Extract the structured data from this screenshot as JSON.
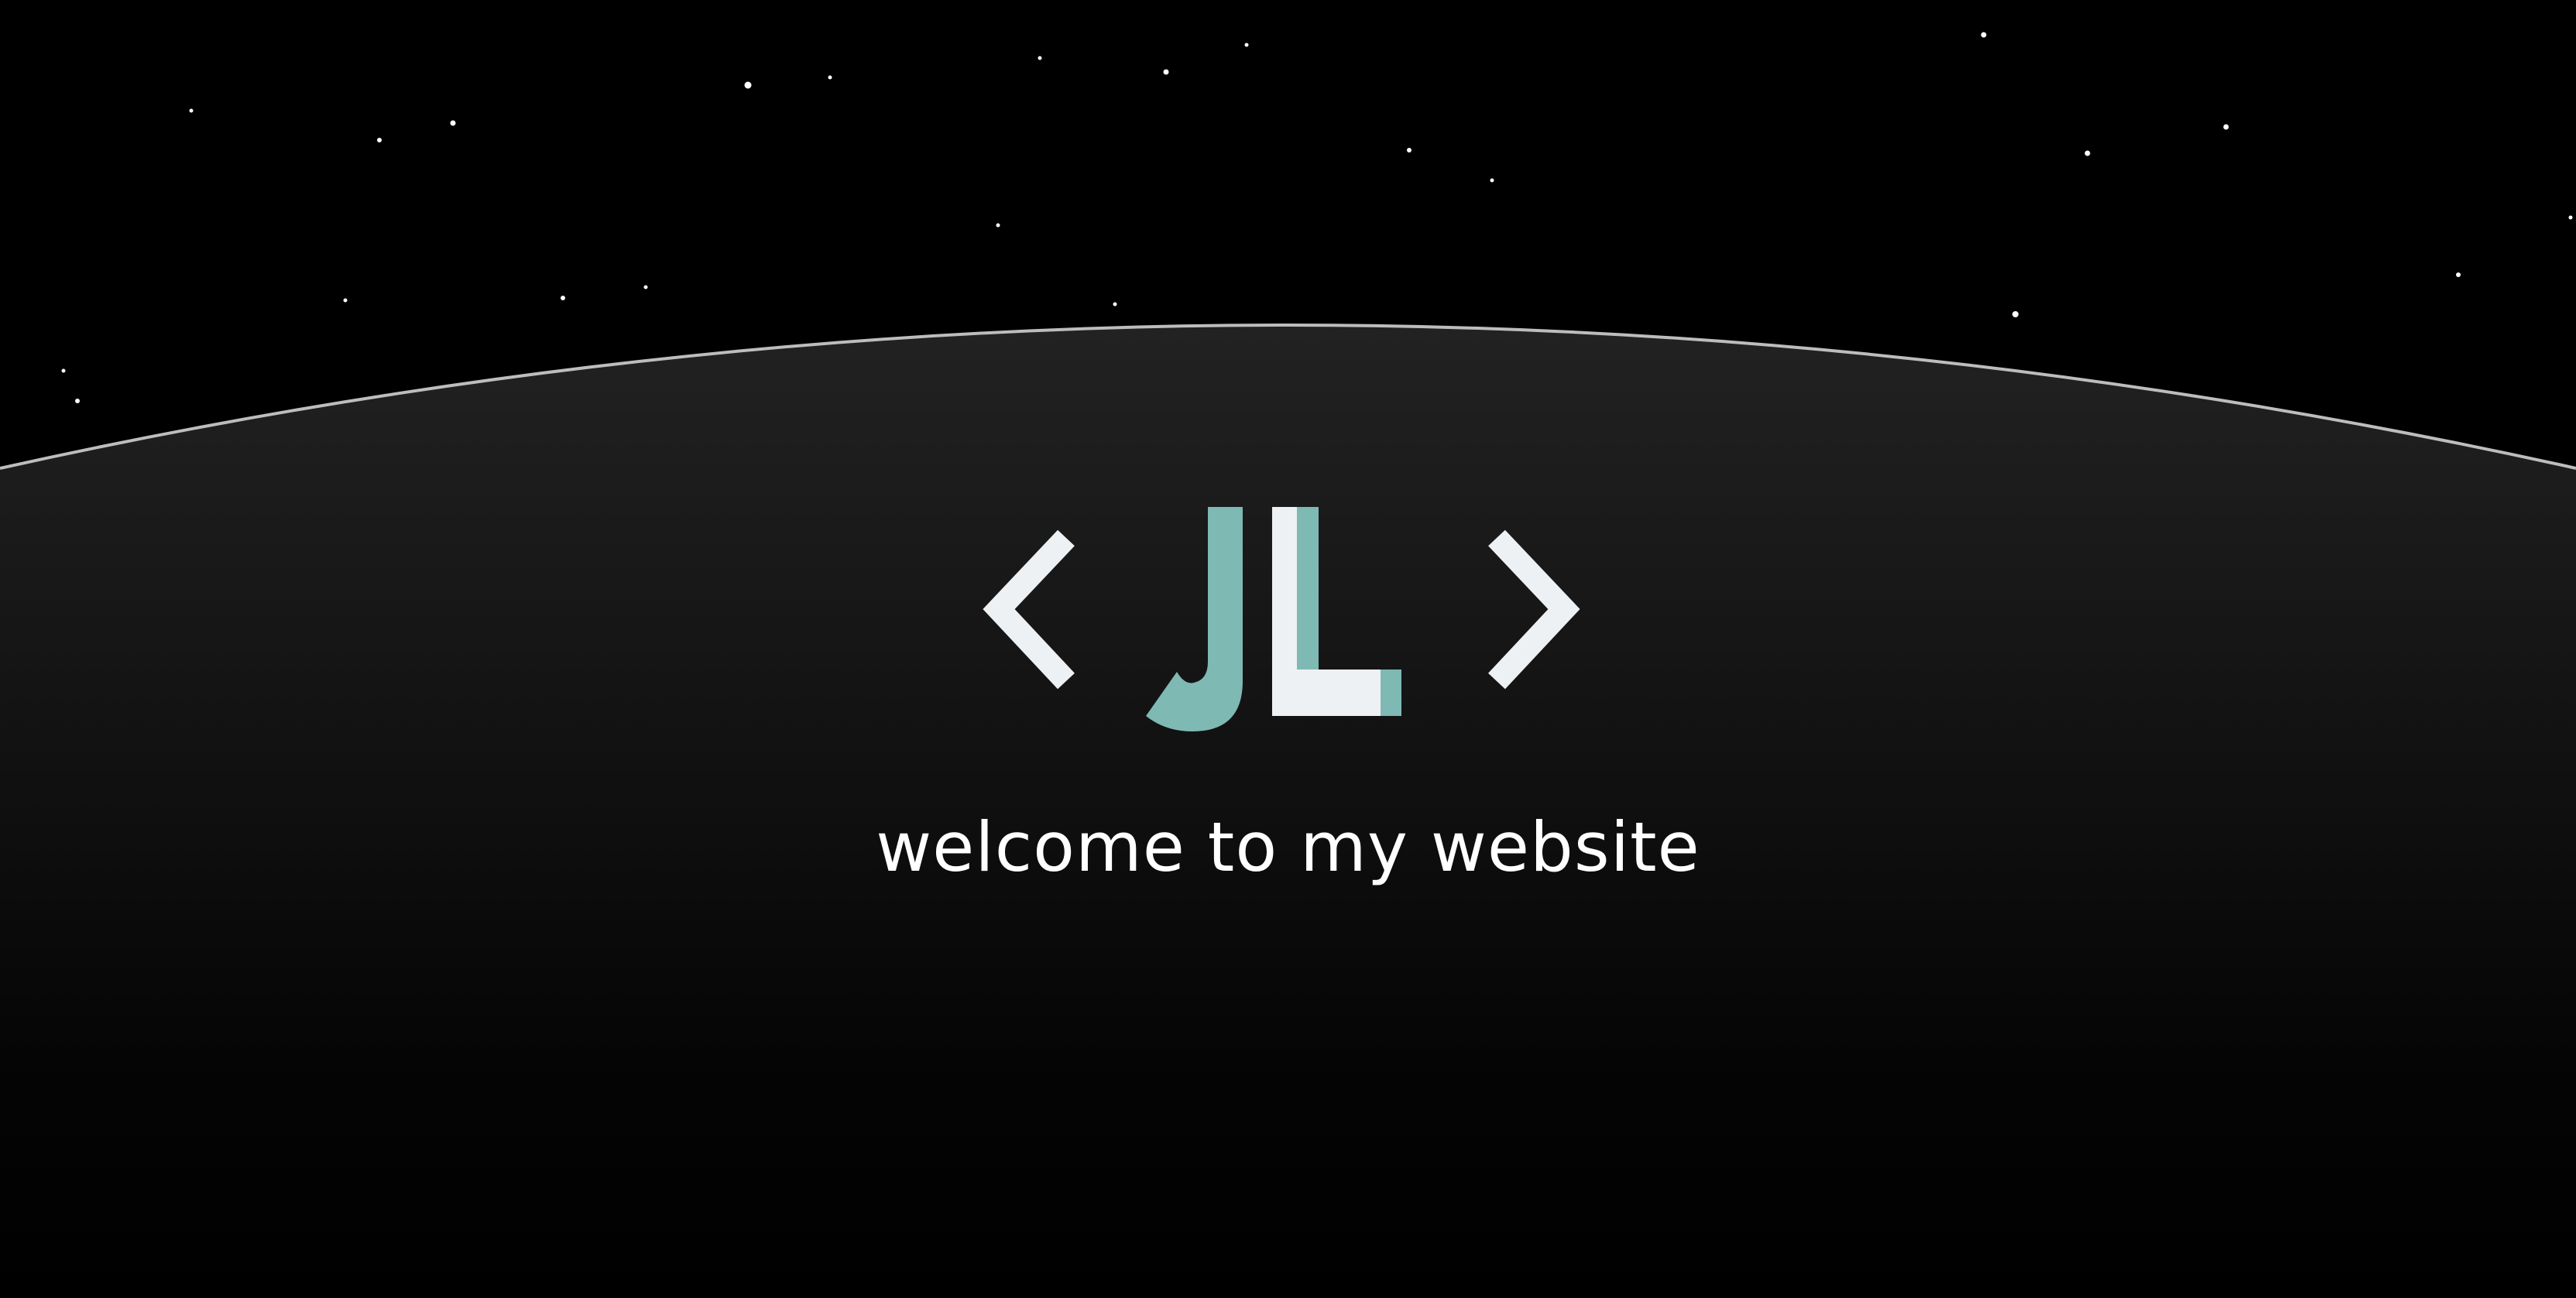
{
  "hero": {
    "tagline": "welcome to my website"
  },
  "logo": {
    "initials": "JL",
    "left_bracket_icon": "chevron-left-icon",
    "right_bracket_icon": "chevron-right-icon"
  },
  "colors": {
    "background": "#000000",
    "planet_top": "#1e1e1e",
    "planet_rim": "#bdbdbd",
    "star": "#ffffff",
    "accent_teal": "#7fb9b3",
    "logo_light": "#eef1f3"
  }
}
